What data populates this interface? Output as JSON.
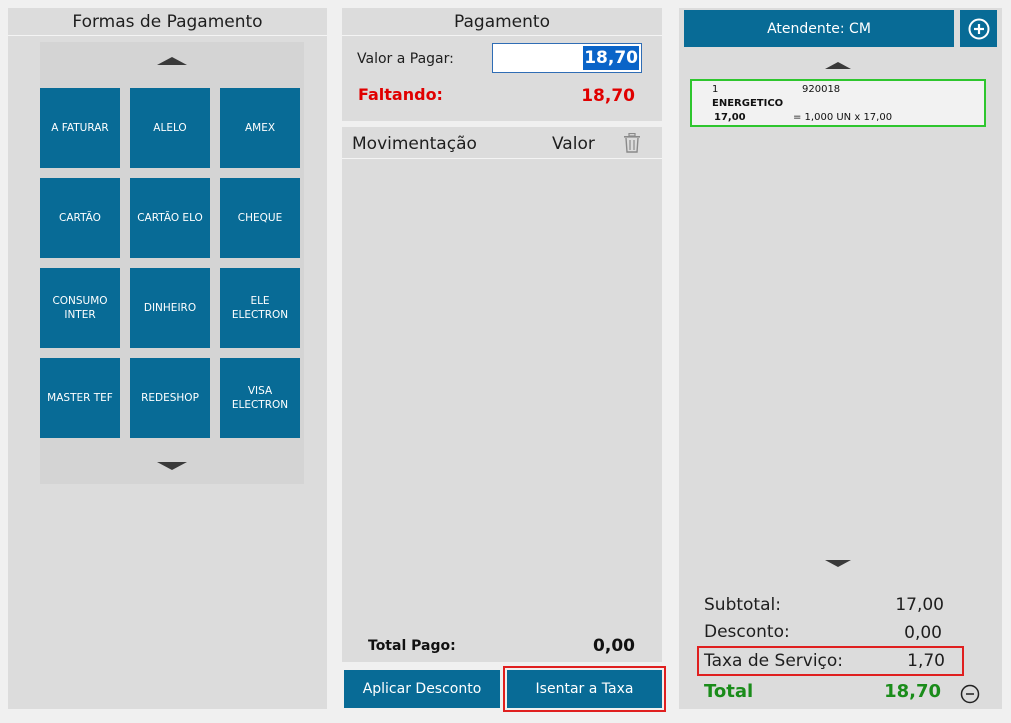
{
  "payment_methods": {
    "title": "Formas de Pagamento",
    "items": [
      "A FATURAR",
      "ALELO",
      "AMEX",
      "CARTÃO",
      "CARTÃO ELO",
      "CHEQUE",
      "CONSUMO INTER",
      "DINHEIRO",
      "ELE ELECTRON",
      "MASTER TEF",
      "REDESHOP",
      "VISA ELECTRON"
    ]
  },
  "payment": {
    "title": "Pagamento",
    "valor_label": "Valor a Pagar:",
    "valor_value": "18,70",
    "faltando_label": "Faltando:",
    "faltando_value": "18,70"
  },
  "movements": {
    "col_movement": "Movimentação",
    "col_value": "Valor",
    "total_label": "Total Pago:",
    "total_value": "0,00"
  },
  "actions": {
    "apply_discount": "Aplicar Desconto",
    "exempt_fee": "Isentar a Taxa"
  },
  "order": {
    "attendant": "Atendente: CM",
    "item": {
      "qty": "1",
      "code": "920018",
      "name": "ENERGETICO",
      "price": "17,00",
      "detail": "= 1,000 UN x 17,00"
    },
    "subtotal_label": "Subtotal:",
    "subtotal_value": "17,00",
    "discount_label": "Desconto:",
    "discount_value": "0,00",
    "service_label": "Taxa de Serviço:",
    "service_value": "1,70",
    "total_label": "Total",
    "total_value": "18,70"
  },
  "colors": {
    "tile_blue": "#086b96",
    "alert_red": "#e00000",
    "total_green": "#1a8c1a",
    "highlight_red": "#e01f1f",
    "selected_green": "#2ec62e"
  },
  "icons": [
    "arrow-up-icon",
    "arrow-down-icon",
    "trash-icon",
    "plus-circle-icon",
    "minus-circle-icon"
  ]
}
